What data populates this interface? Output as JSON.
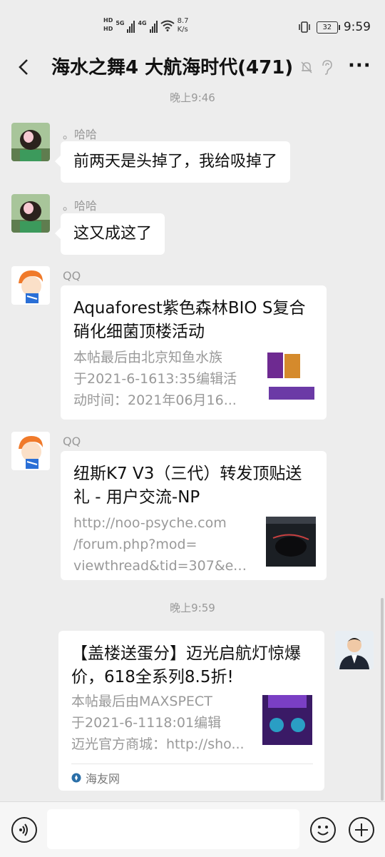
{
  "status_bar": {
    "hd1": "HD",
    "hd2": "HD",
    "gen1": "5G",
    "gen2": "4G",
    "speed_value": "8.7",
    "speed_unit": "K/s",
    "battery": "32",
    "time": "9:59"
  },
  "header": {
    "title": "海水之舞4 大航海时代(471)",
    "back_icon": "chevron-left-icon",
    "mute_icon": "bell-off-icon",
    "ear_icon": "ear-icon",
    "more_label": "···"
  },
  "messages": [
    {
      "type": "time",
      "text": "晚上9:46"
    },
    {
      "type": "text",
      "sender": "。哈哈",
      "text": "前两天是头掉了，我给吸掉了"
    },
    {
      "type": "text",
      "sender": "。哈哈",
      "text": "这又成这了"
    },
    {
      "type": "card",
      "sender": "QQ",
      "title": "Aquaforest紫色森林BIO S复合硝化细菌顶楼活动",
      "desc_lines": [
        "本帖最后由北京知鱼水族",
        "于2021-6-1613:35编辑活",
        "动时间：2021年06月16..."
      ]
    },
    {
      "type": "card",
      "sender": "QQ",
      "title": "纽斯K7 V3（三代）转发顶贴送礼 - 用户交流-NP",
      "desc_lines": [
        "http://noo-psyche.com",
        "/forum.php?mod=",
        "viewthread&tid=307&extr..."
      ]
    },
    {
      "type": "time",
      "text": "晚上9:59"
    },
    {
      "type": "card",
      "sender": "",
      "title": "【盖楼送蛋分】迈光启航灯惊爆价，618全系列8.5折!",
      "desc_lines": [
        "本帖最后由MAXSPECT",
        "于2021-6-1118:01编辑",
        "迈光官方商城：http://sho..."
      ],
      "source": "海友网"
    }
  ],
  "bottom_bar": {
    "voice_icon": "voice-icon",
    "input_value": "",
    "emoji_icon": "emoji-icon",
    "plus_icon": "plus-circle-icon"
  }
}
